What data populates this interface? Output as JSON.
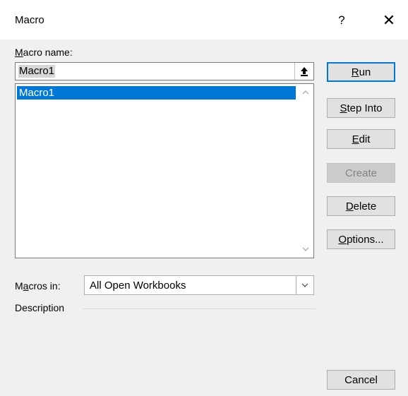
{
  "window": {
    "title": "Macro",
    "help_label": "?",
    "close_label": "✕"
  },
  "macro_name": {
    "label_prefix": "",
    "label_accesskey": "M",
    "label_rest": "acro name:",
    "value": "Macro1"
  },
  "macro_list": {
    "items": [
      "Macro1"
    ],
    "selected": "Macro1"
  },
  "buttons": {
    "run": {
      "accesskey": "R",
      "rest": "un"
    },
    "step_into": {
      "accesskey": "S",
      "rest": "tep Into"
    },
    "edit": {
      "accesskey": "E",
      "rest": "dit"
    },
    "create": {
      "label": "Create"
    },
    "delete": {
      "accesskey": "D",
      "rest": "elete"
    },
    "options": {
      "accesskey": "O",
      "rest": "ptions..."
    },
    "cancel": {
      "label": "Cancel"
    }
  },
  "macros_in": {
    "label_prefix": "M",
    "label_accesskey": "a",
    "label_rest": "cros in:",
    "selected": "All Open Workbooks"
  },
  "description": {
    "label": "Description"
  },
  "icons": {
    "upload": "upload-arrow-icon",
    "scroll_up": "chevron-up-icon",
    "scroll_down": "chevron-down-icon",
    "dropdown": "chevron-down-icon"
  },
  "colors": {
    "selection": "#0078d7",
    "default_button_border": "#0078d7",
    "dialog_background": "#f0f0f0"
  }
}
